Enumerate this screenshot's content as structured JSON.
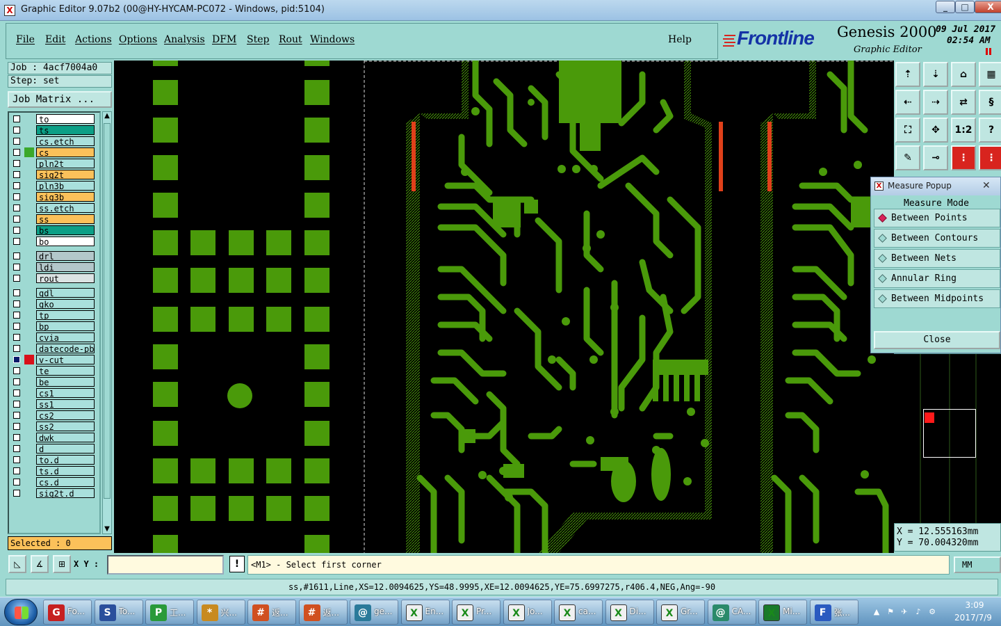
{
  "window": {
    "title": "Graphic Editor 9.07b2 (00@HY-HYCAM-PC072 - Windows, pid:5104)",
    "minimize": "_",
    "maximize": "□",
    "close": "X"
  },
  "menu": {
    "items": [
      "File",
      "Edit",
      "Actions",
      "Options",
      "Analysis",
      "DFM",
      "Step",
      "Rout",
      "Windows"
    ],
    "help": "Help"
  },
  "brand": {
    "logo": "Frontline",
    "product": "Genesis 2000",
    "subtitle": "Graphic Editor",
    "date": "09 Jul 2017",
    "time": "02:54 AM"
  },
  "job": {
    "job_line": "Job : 4acf7004a0",
    "step_line": "Step: set",
    "matrix_button": "Job Matrix ...",
    "selected": "Selected : 0"
  },
  "layers": [
    {
      "name": "to",
      "color": "white",
      "indicator": "none"
    },
    {
      "name": "ts",
      "color": "teal",
      "indicator": "none"
    },
    {
      "name": "cs.etch",
      "color": "cyan",
      "indicator": "none"
    },
    {
      "name": "cs",
      "color": "orange",
      "indicator": "green"
    },
    {
      "name": "pln2t",
      "color": "cyan",
      "indicator": "none"
    },
    {
      "name": "sig2t",
      "color": "orange",
      "indicator": "none"
    },
    {
      "name": "pln3b",
      "color": "cyan",
      "indicator": "none"
    },
    {
      "name": "sig3b",
      "color": "orange",
      "indicator": "none"
    },
    {
      "name": "ss.etch",
      "color": "cyan",
      "indicator": "none"
    },
    {
      "name": "ss",
      "color": "orange",
      "indicator": "none"
    },
    {
      "name": "bs",
      "color": "teal",
      "indicator": "none"
    },
    {
      "name": "bo",
      "color": "white",
      "indicator": "none"
    },
    {
      "name": "drl",
      "color": "grey",
      "indicator": "none"
    },
    {
      "name": "ldi",
      "color": "grey",
      "indicator": "none"
    },
    {
      "name": "rout",
      "color": "lgrey",
      "indicator": "none"
    },
    {
      "name": "gdl",
      "color": "cyan",
      "indicator": "none"
    },
    {
      "name": "gko",
      "color": "cyan",
      "indicator": "none"
    },
    {
      "name": "tp",
      "color": "cyan",
      "indicator": "none"
    },
    {
      "name": "bp",
      "color": "cyan",
      "indicator": "none"
    },
    {
      "name": "cvia",
      "color": "cyan",
      "indicator": "none"
    },
    {
      "name": "datecode-pbe",
      "color": "cyan",
      "indicator": "none"
    },
    {
      "name": "v-cut",
      "color": "cyan",
      "indicator": "red"
    },
    {
      "name": "te",
      "color": "cyan",
      "indicator": "none"
    },
    {
      "name": "be",
      "color": "cyan",
      "indicator": "none"
    },
    {
      "name": "cs1",
      "color": "cyan",
      "indicator": "none"
    },
    {
      "name": "ss1",
      "color": "cyan",
      "indicator": "none"
    },
    {
      "name": "cs2",
      "color": "cyan",
      "indicator": "none"
    },
    {
      "name": "ss2",
      "color": "cyan",
      "indicator": "none"
    },
    {
      "name": "dwk",
      "color": "cyan",
      "indicator": "none"
    },
    {
      "name": "d",
      "color": "cyan",
      "indicator": "none"
    },
    {
      "name": "to.d",
      "color": "cyan",
      "indicator": "none"
    },
    {
      "name": "ts.d",
      "color": "cyan",
      "indicator": "none"
    },
    {
      "name": "cs.d",
      "color": "cyan",
      "indicator": "none"
    },
    {
      "name": "sig2t.d",
      "color": "cyan",
      "indicator": "none"
    }
  ],
  "measure_popup": {
    "title": "Measure Popup",
    "header": "Measure Mode",
    "options": [
      "Between Points",
      "Between Contours",
      "Between Nets",
      "Annular Ring",
      "Between Midpoints"
    ],
    "selected": "Between Points",
    "close": "Close"
  },
  "tools": {
    "ratio_label": "1:2",
    "help_label": "?"
  },
  "coords": {
    "x": "X  = 12.555163mm",
    "y": "Y  = 70.004320mm"
  },
  "command": {
    "xy_label": "X Y :",
    "xy_value": "",
    "prompt": "<M1> - Select first corner",
    "units": "MM"
  },
  "status": "ss,#1611,Line,XS=12.0094625,YS=48.9995,XE=12.0094625,YE=75.6997275,r406.4,NEG,Ang=-90",
  "taskbar": {
    "apps": [
      {
        "label": "Fo...",
        "icon": "G"
      },
      {
        "label": "To...",
        "icon": "S"
      },
      {
        "label": "工...",
        "icon": "P"
      },
      {
        "label": "兴...",
        "icon": "*"
      },
      {
        "label": "返...",
        "icon": "#"
      },
      {
        "label": "返...",
        "icon": "#"
      },
      {
        "label": "ge...",
        "icon": "@"
      },
      {
        "label": "En...",
        "icon": "X"
      },
      {
        "label": "Pr...",
        "icon": "X"
      },
      {
        "label": "Jo...",
        "icon": "X"
      },
      {
        "label": "ca...",
        "icon": "X"
      },
      {
        "label": "Di...",
        "icon": "X"
      },
      {
        "label": "Gr...",
        "icon": "X"
      },
      {
        "label": "CA...",
        "icon": "@"
      },
      {
        "label": "Mi...",
        "icon": "X"
      },
      {
        "label": "张...",
        "icon": "F"
      }
    ],
    "time": "3:09",
    "date": "2017/7/9"
  },
  "colors": {
    "copper": "#4a9a0a",
    "background": "#000000",
    "highlight": "#e0401a",
    "panel": "#9ed9d2"
  }
}
